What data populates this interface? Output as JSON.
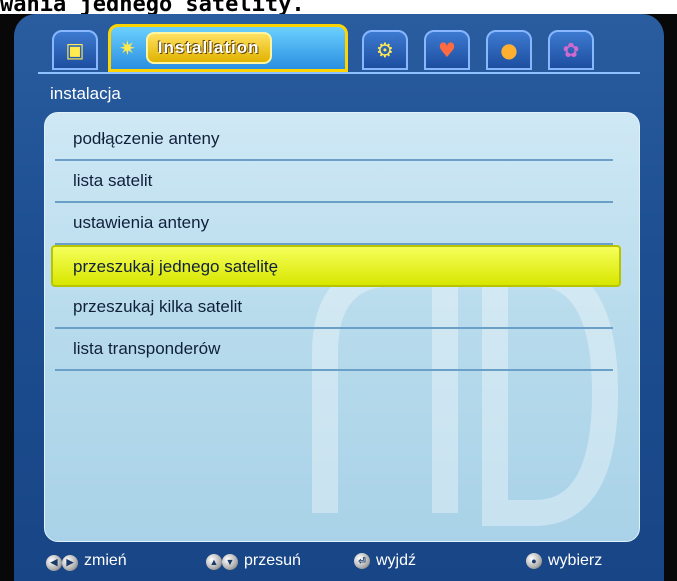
{
  "page_caption": "wania jednego satelity.",
  "tabs": [
    {
      "name": "tab-tv",
      "icon": "tv-icon",
      "glyph": "▣"
    },
    {
      "name": "tab-installation",
      "icon": "satellite-dish-icon",
      "glyph": "✷",
      "label": "Installation",
      "active": true
    },
    {
      "name": "tab-settings",
      "icon": "tools-icon",
      "glyph": "⚙"
    },
    {
      "name": "tab-favorites",
      "icon": "heart-icon",
      "glyph": "♥"
    },
    {
      "name": "tab-games",
      "icon": "ball-icon",
      "glyph": "●"
    },
    {
      "name": "tab-system",
      "icon": "gear-icon",
      "glyph": "✿"
    }
  ],
  "section_title": "instalacja",
  "menu_items": [
    "podłączenie anteny",
    "lista satelit",
    "ustawienia anteny",
    "przeszukaj jednego satelitę",
    "przeszukaj kilka satelit",
    "lista transponderów"
  ],
  "selected_index": 3,
  "footer": {
    "change": {
      "keys": "left-right-keys-icon",
      "label": "zmień"
    },
    "move": {
      "keys": "up-down-keys-icon",
      "label": "przesuń"
    },
    "exit": {
      "keys": "exit-key-icon",
      "label": "wyjdź"
    },
    "select": {
      "keys": "ok-key-icon",
      "label": "wybierz"
    }
  },
  "colors": {
    "frame": "#1d4f92",
    "panel": "#b7dbec",
    "highlight": "#e8f000",
    "active_tab_border": "#ffd400"
  }
}
